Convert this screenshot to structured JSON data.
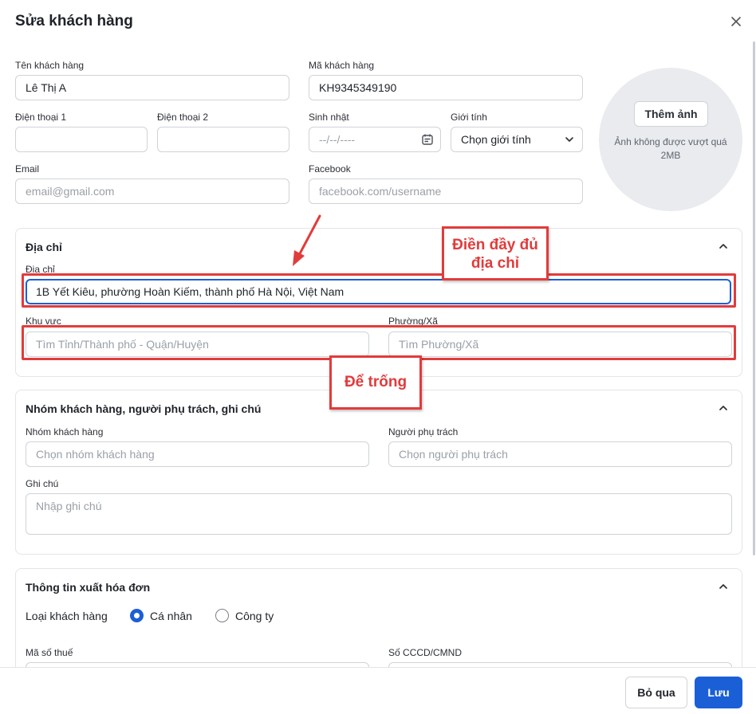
{
  "dialog": {
    "title": "Sửa khách hàng",
    "close_icon": "close-icon"
  },
  "fields": {
    "name": {
      "label": "Tên khách hàng",
      "value": "Lê Thị A"
    },
    "code": {
      "label": "Mã khách hàng",
      "value": "KH9345349190"
    },
    "phone1": {
      "label": "Điện thoại 1",
      "value": ""
    },
    "phone2": {
      "label": "Điện thoại 2",
      "value": ""
    },
    "birthday": {
      "label": "Sinh nhật",
      "placeholder": "--/--/----"
    },
    "gender": {
      "label": "Giới tính",
      "value": "Chọn giới tính"
    },
    "email": {
      "label": "Email",
      "placeholder": "email@gmail.com"
    },
    "facebook": {
      "label": "Facebook",
      "placeholder": "facebook.com/username"
    }
  },
  "avatar": {
    "button": "Thêm ảnh",
    "note": "Ảnh không được vượt quá 2MB"
  },
  "address_section": {
    "title": "Địa chỉ",
    "address": {
      "label": "Địa chỉ",
      "value": "1B Yết Kiêu, phường Hoàn Kiếm, thành phố Hà Nội, Việt Nam"
    },
    "region": {
      "label": "Khu vực",
      "placeholder": "Tìm Tỉnh/Thành phố - Quận/Huyện"
    },
    "ward": {
      "label": "Phường/Xã",
      "placeholder": "Tìm Phường/Xã"
    }
  },
  "group_section": {
    "title": "Nhóm khách hàng, người phụ trách, ghi chú",
    "group": {
      "label": "Nhóm khách hàng",
      "placeholder": "Chọn nhóm khách hàng"
    },
    "owner": {
      "label": "Người phụ trách",
      "placeholder": "Chọn người phụ trách"
    },
    "note": {
      "label": "Ghi chú",
      "placeholder": "Nhập ghi chú"
    }
  },
  "invoice_section": {
    "title": "Thông tin xuất hóa đơn",
    "customer_type_label": "Loại khách hàng",
    "options": [
      "Cá nhân",
      "Công ty"
    ],
    "selected": "Cá nhân",
    "tax_code": {
      "label": "Mã số thuế"
    },
    "id_number": {
      "label": "Số CCCD/CMND"
    }
  },
  "footer": {
    "cancel": "Bỏ qua",
    "save": "Lưu"
  },
  "annotations": {
    "fill_address": "Điền đầy đủ địa chỉ",
    "leave_empty": "Để trống",
    "color": "#e23b3b"
  },
  "colors": {
    "accent": "#1b5fd6"
  }
}
